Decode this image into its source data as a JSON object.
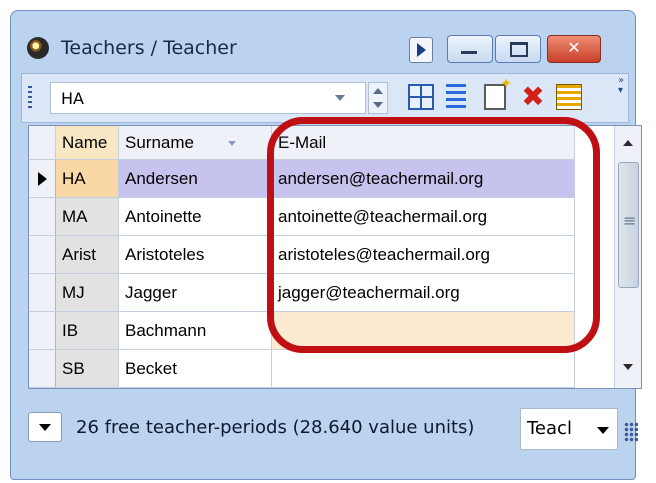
{
  "window": {
    "title": "Teachers / Teacher",
    "close_label": "✕"
  },
  "toolbar": {
    "current_value": "HA",
    "icons": [
      "grid-settings-icon",
      "list-view-icon",
      "new-record-icon",
      "delete-icon",
      "edit-fields-icon"
    ]
  },
  "table": {
    "columns": [
      "Name",
      "Surname",
      "E-Mail"
    ],
    "rows": [
      {
        "name": "HA",
        "surname": "Andersen",
        "email": "andersen@teachermail.org",
        "selected": true
      },
      {
        "name": "MA",
        "surname": "Antoinette",
        "email": "antoinette@teachermail.org"
      },
      {
        "name": "Arist",
        "surname": "Aristoteles",
        "email": "aristoteles@teachermail.org"
      },
      {
        "name": "MJ",
        "surname": "Jagger",
        "email": "jagger@teachermail.org"
      },
      {
        "name": "IB",
        "surname": "Bachmann",
        "email": ""
      },
      {
        "name": "SB",
        "surname": "Becket",
        "email": ""
      }
    ]
  },
  "status": {
    "text": "26 free teacher-periods (28.640 value units)",
    "selector_value": "Teacl"
  },
  "colors": {
    "highlight": "#c00f12",
    "selected_row": "#c6c4ee",
    "name_column_selected": "#f9d8a6",
    "window_frame": "#bcd3ef"
  }
}
